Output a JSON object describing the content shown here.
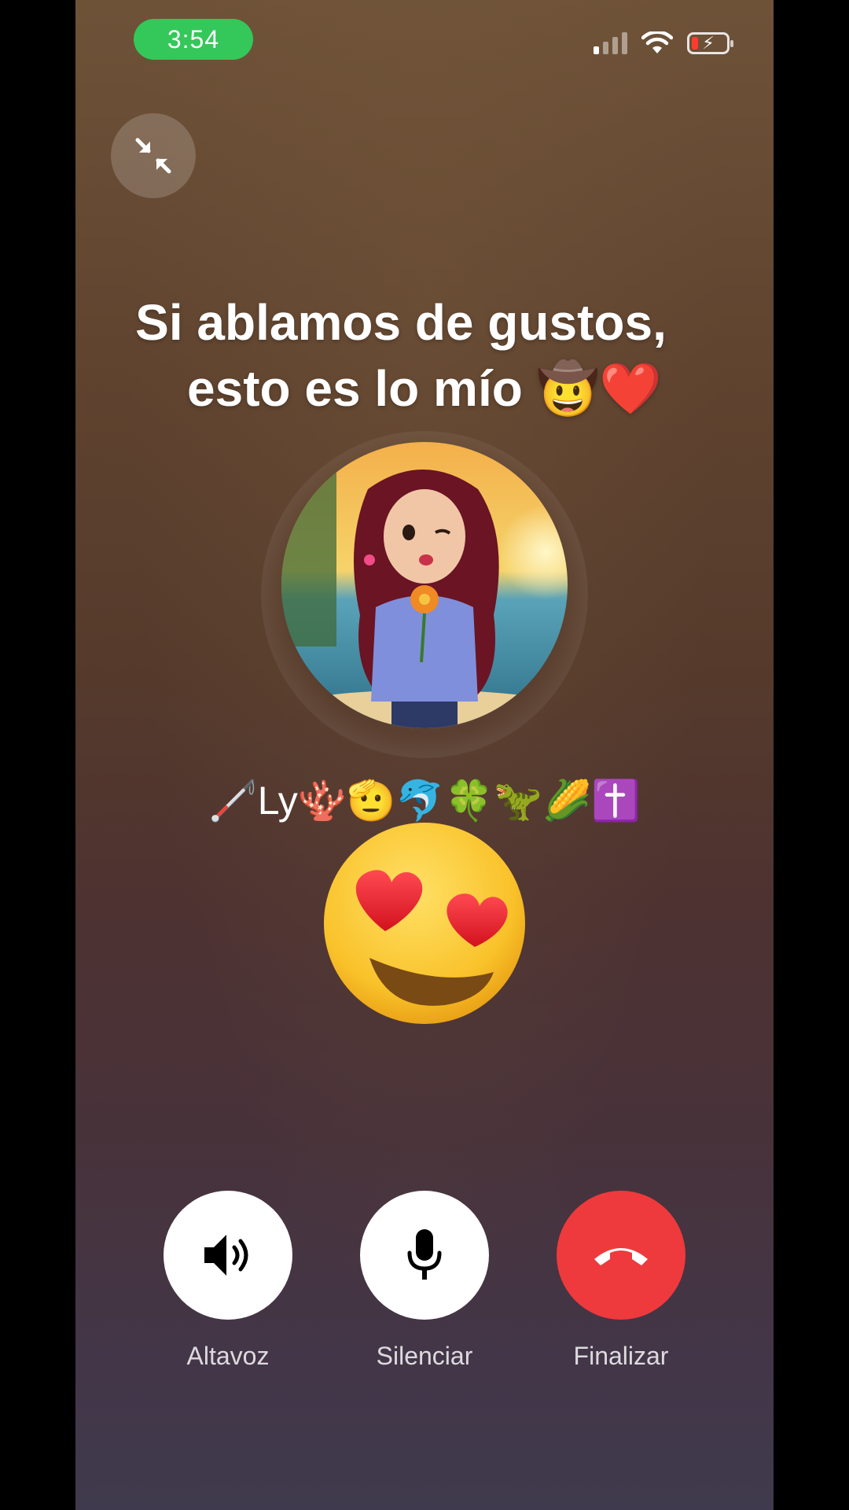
{
  "status_bar": {
    "time": "3:54",
    "icons": [
      "cellular-signal-icon",
      "wifi-icon",
      "battery-charging-icon"
    ],
    "time_pill_color": "#34c759",
    "battery_level_color": "#ff3b30"
  },
  "minimize_icon": "minimize-arrows-icon",
  "caption": {
    "line1": "Si ablamos de gustos,",
    "line2": "esto es lo mío 🤠❤️"
  },
  "contact": {
    "name": "🦯Ly🪸🫡🐬🍀🦖🌽✝️"
  },
  "overlay_emoji": "heart-eyes-emoji",
  "controls": [
    {
      "label": "Altavoz",
      "icon": "speaker-icon"
    },
    {
      "label": "Silenciar",
      "icon": "microphone-icon"
    },
    {
      "label": "Finalizar",
      "icon": "end-call-icon",
      "color": "#ee3a3c"
    }
  ]
}
